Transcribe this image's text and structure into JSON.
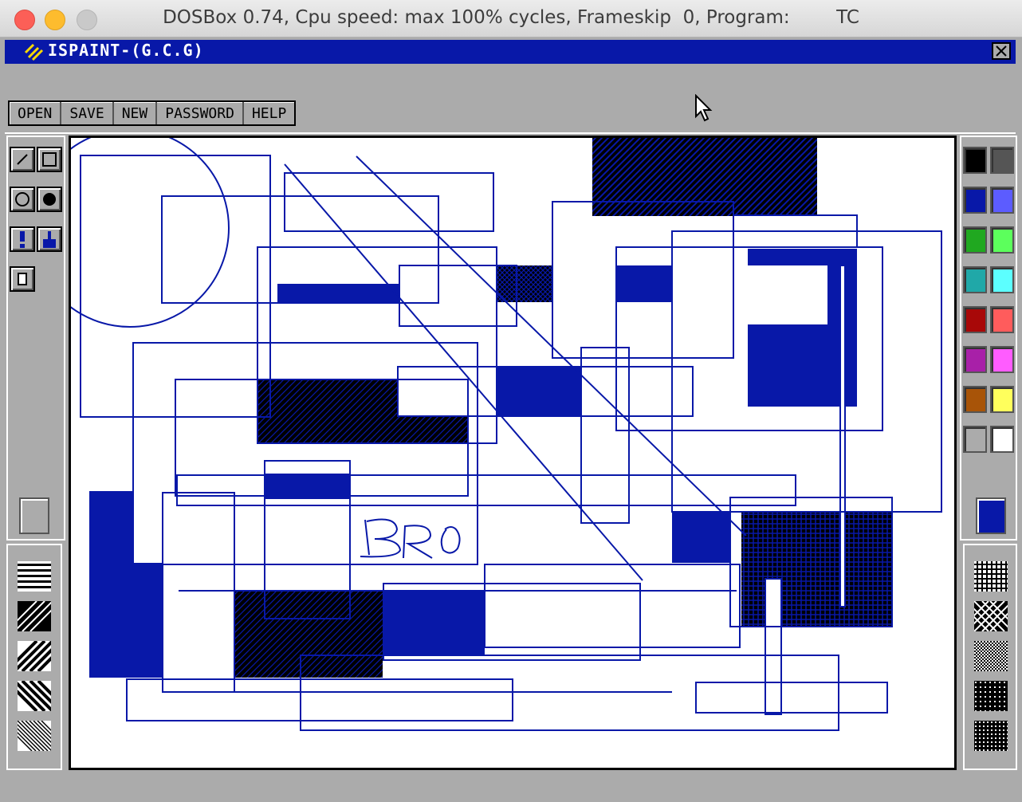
{
  "window": {
    "title": "DOSBox 0.74, Cpu speed: max 100% cycles, Frameskip  0, Program:        TC"
  },
  "app": {
    "title": "ISPAINT-(G.C.G)"
  },
  "menu": [
    {
      "label": "OPEN"
    },
    {
      "label": "SAVE"
    },
    {
      "label": "NEW"
    },
    {
      "label": "PASSWORD"
    },
    {
      "label": "HELP"
    }
  ],
  "tools": [
    "line-tool-icon",
    "rectangle-tool-icon",
    "circle-tool-icon",
    "filled-circle-tool-icon",
    "spray-tool-icon",
    "fill-tool-icon",
    "eraser-tool-icon"
  ],
  "palette": [
    "#000000",
    "#555555",
    "#0818a8",
    "#5c5cff",
    "#20a820",
    "#5cff5c",
    "#20a8a8",
    "#5cffff",
    "#a80808",
    "#ff5c5c",
    "#a820a8",
    "#ff5cff",
    "#a85408",
    "#ffff5c",
    "#ababab",
    "#ffffff"
  ],
  "current_color": "#0818a8",
  "accent": "#0818a8",
  "canvas_text": "BRO"
}
